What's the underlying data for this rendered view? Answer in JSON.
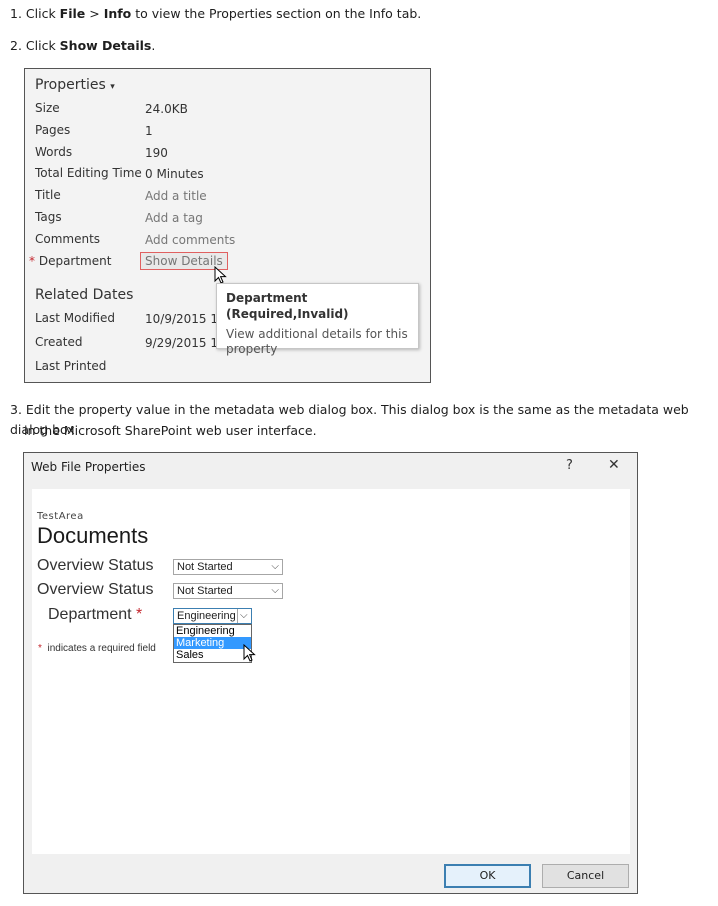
{
  "steps": {
    "s1_prefix": "1. Click ",
    "s1_file": "File",
    "s1_gt": " > ",
    "s1_info": "Info",
    "s1_rest": " to view the Properties section on the Info tab.",
    "s2_prefix": "2. Click ",
    "s2_bold": "Show Details",
    "s2_rest": ".",
    "s3_line1": "3. Edit the property value in the metadata web dialog box. This dialog box is the same as the metadata web dialog box",
    "s3_line2": "in the Microsoft SharePoint web user interface."
  },
  "properties": {
    "header": "Properties",
    "header_caret": "▾",
    "rows": [
      {
        "label": "Size",
        "value": "24.0KB"
      },
      {
        "label": "Pages",
        "value": "1"
      },
      {
        "label": "Words",
        "value": "190"
      },
      {
        "label": "Total Editing Time",
        "value": "0 Minutes"
      },
      {
        "label": "Title",
        "value": "Add a title"
      },
      {
        "label": "Tags",
        "value": "Add a tag"
      },
      {
        "label": "Comments",
        "value": "Add comments"
      }
    ],
    "department_star": "*",
    "department_label": "Department",
    "show_details": "Show Details",
    "related_header": "Related Dates",
    "dates": [
      {
        "label": "Last Modified",
        "value": "10/9/2015 11:"
      },
      {
        "label": "Created",
        "value": "9/29/2015 12:"
      },
      {
        "label": "Last Printed",
        "value": ""
      }
    ],
    "tooltip_title": "Department (Required,Invalid)",
    "tooltip_body": "View additional details for this property"
  },
  "dialog": {
    "title": "Web File Properties",
    "help": "?",
    "close": "✕",
    "site": "TestArea",
    "library": "Documents",
    "fields": [
      {
        "label": "Overview Status",
        "value": "Not Started"
      },
      {
        "label": "Overview Status",
        "value": "Not Started"
      }
    ],
    "department_label": "Department",
    "department_star": "*",
    "department_value": "Engineering",
    "options": [
      "Engineering",
      "Marketing",
      "Sales"
    ],
    "selected_option": "Marketing",
    "required_star": "*",
    "required_note": "indicates a required field",
    "ok": "OK",
    "cancel": "Cancel"
  }
}
